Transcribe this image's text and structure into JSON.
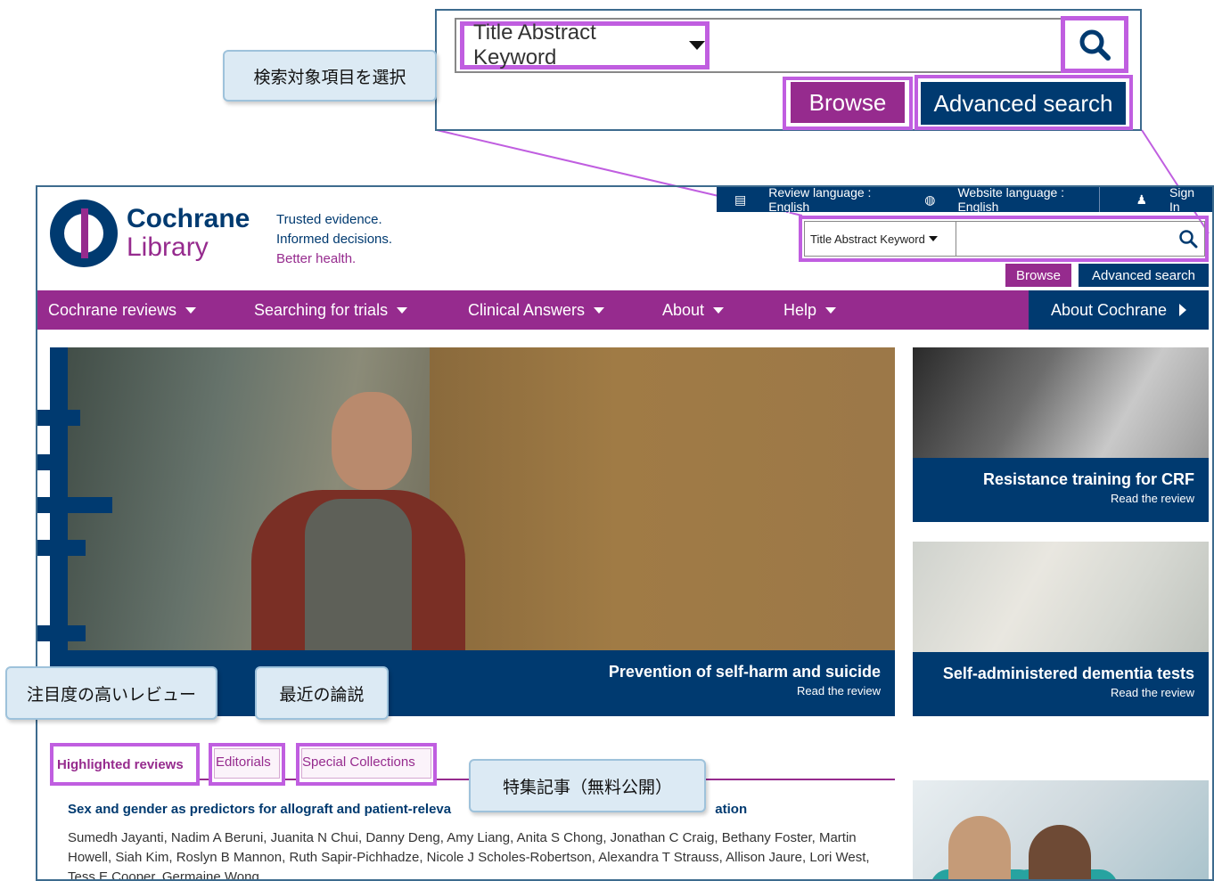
{
  "zoom": {
    "dropdown_label": "Title Abstract Keyword",
    "browse_label": "Browse",
    "advanced_label": "Advanced search"
  },
  "callouts": {
    "select_field": "検索対象項目を選択",
    "highlighted": "注目度の高いレビュー",
    "editorials": "最近の論説",
    "special": "特集記事（無料公開）"
  },
  "header": {
    "logo_line1": "Cochrane",
    "logo_line2": "Library",
    "tagline1": "Trusted evidence.",
    "tagline2": "Informed decisions.",
    "tagline3": "Better health.",
    "review_language": "Review language : English",
    "website_language": "Website language : English",
    "sign_in": "Sign In"
  },
  "search": {
    "dropdown_label": "Title Abstract Keyword",
    "browse_label": "Browse",
    "advanced_label": "Advanced search"
  },
  "nav": {
    "items": [
      {
        "label": "Cochrane reviews"
      },
      {
        "label": "Searching for trials"
      },
      {
        "label": "Clinical Answers"
      },
      {
        "label": "About"
      },
      {
        "label": "Help"
      }
    ],
    "about_cochrane": "About Cochrane"
  },
  "hero": {
    "title": "Prevention of self-harm and suicide",
    "link": "Read the review"
  },
  "side_cards": [
    {
      "title": "Resistance training for CRF",
      "link": "Read the review"
    },
    {
      "title": "Self-administered dementia tests",
      "link": "Read the review"
    }
  ],
  "tabs": {
    "highlighted": "Highlighted reviews",
    "editorials": "Editorials",
    "special": "Special Collections"
  },
  "article": {
    "title_start": "Sex and gender as predictors for allograft and patient-releva",
    "title_end": "ation",
    "authors": "Sumedh Jayanti, Nadim A Beruni, Juanita N Chui, Danny Deng, Amy Liang, Anita S Chong, Jonathan C Craig, Bethany Foster, Martin Howell, Siah Kim, Roslyn B Mannon, Ruth Sapir-Pichhadze, Nicole J Scholes-Robertson, Alexandra T Strauss, Allison Jaure, Lori West, Tess E Cooper, Germaine Wong"
  },
  "colors": {
    "purple": "#962b8e",
    "navy": "#003a70",
    "highlight": "#c05ee0",
    "callout_bg": "#dceaf4"
  }
}
